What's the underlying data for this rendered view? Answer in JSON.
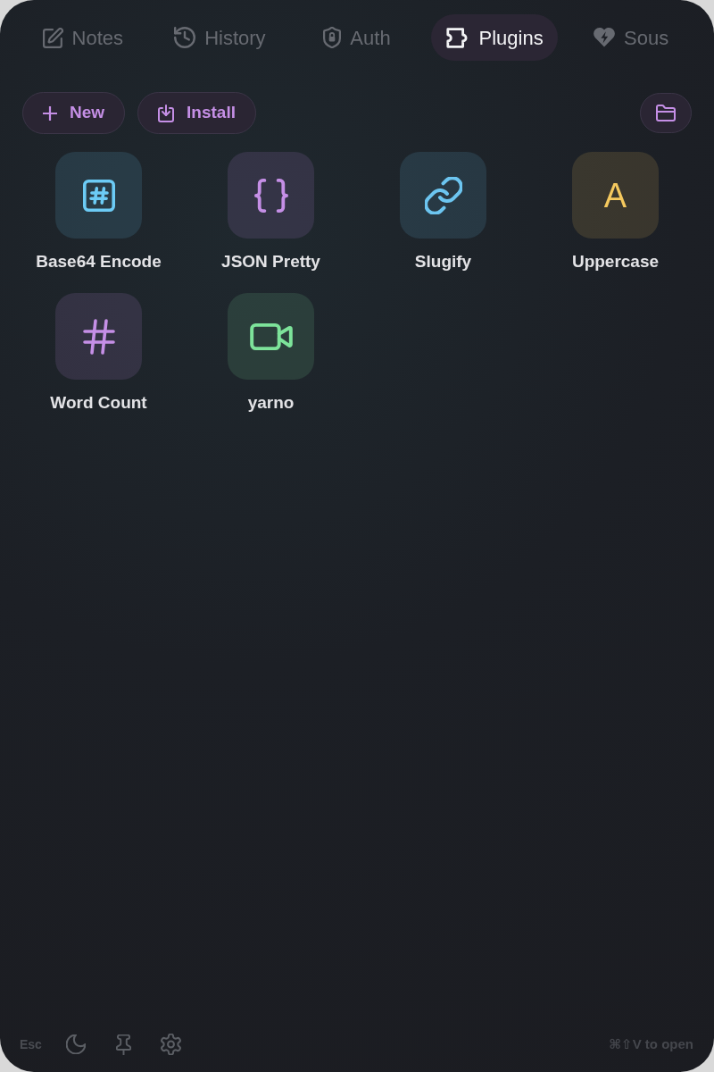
{
  "tabs": [
    {
      "label": "Notes",
      "selected": false
    },
    {
      "label": "History",
      "selected": false
    },
    {
      "label": "Auth",
      "selected": false
    },
    {
      "label": "Plugins",
      "selected": true
    },
    {
      "label": "Sous",
      "selected": false
    }
  ],
  "toolbar": {
    "buttons": [
      {
        "label": "New"
      },
      {
        "label": "Install"
      }
    ]
  },
  "plugins": [
    {
      "label": "Base64 Encode",
      "kind": "icon",
      "color": "#6ccbf5"
    },
    {
      "label": "JSON Pretty",
      "kind": "icon",
      "color": "#c58fe6"
    },
    {
      "label": "Slugify",
      "kind": "icon",
      "color": "#6cc5f0"
    },
    {
      "label": "Uppercase",
      "kind": "letter",
      "glyph": "A",
      "color": "#f5c95e"
    },
    {
      "label": "Word Count",
      "kind": "icon",
      "color": "#c58fe6"
    },
    {
      "label": "yarno",
      "kind": "icon",
      "color": "#7de39a"
    }
  ],
  "footer": {
    "escape_hint": "Esc",
    "shortcut_hint": "⌘⇧V to open"
  }
}
